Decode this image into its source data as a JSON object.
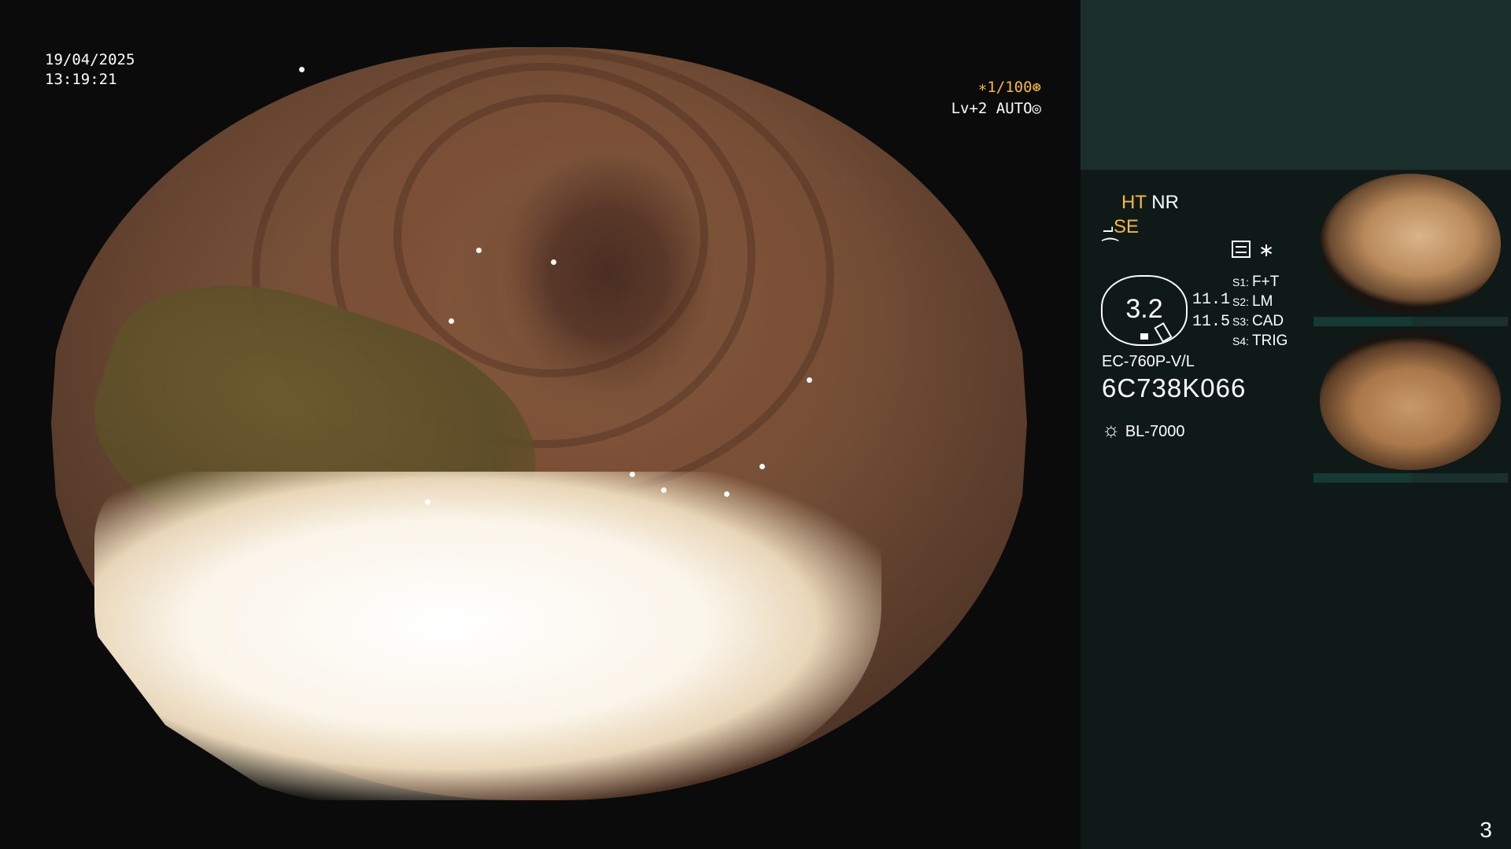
{
  "overlay": {
    "date": "19/04/2025",
    "time": "13:19:21",
    "shutter": "∗1/100",
    "shutter_icon": "aperture-icon",
    "auto_mode": "Lv+2 AUTO",
    "auto_icon": "iris-icon"
  },
  "panel": {
    "ht": "HT",
    "nr": "NR",
    "se": "SE",
    "se_icon": "structure-enhance-icon",
    "f_icon_glyph": "⁀",
    "star": "∗",
    "gauge_value": "3.2",
    "val1": "11.1",
    "val2": "11.5",
    "slots": [
      {
        "key": "S1:",
        "value": "F+T"
      },
      {
        "key": "S2:",
        "value": "LM"
      },
      {
        "key": "S3:",
        "value": "CAD"
      },
      {
        "key": "S4:",
        "value": "TRIG"
      }
    ],
    "scope_model": "EC-760P-V/L",
    "serial": "6C738K066",
    "light_source": "BL-7000",
    "page_index": "3"
  },
  "colors": {
    "accent": "#f5b847",
    "panel_top": "#1b302d",
    "panel_bg": "#0f1a18"
  }
}
